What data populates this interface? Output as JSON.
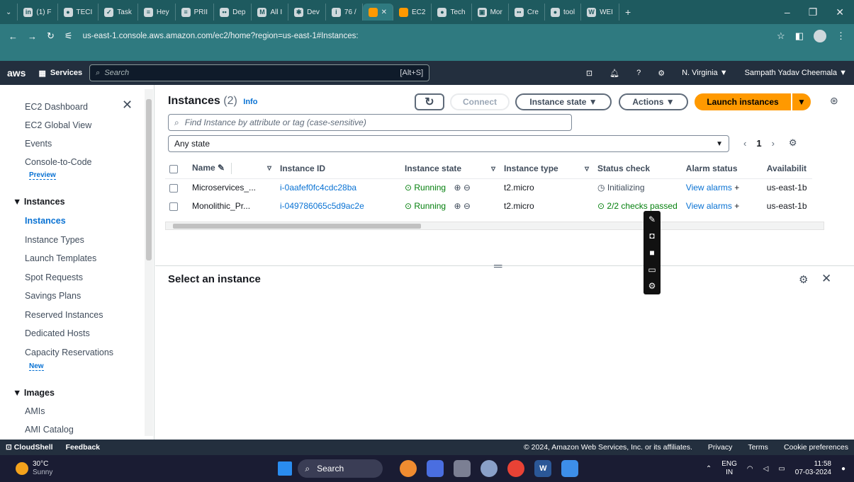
{
  "browser": {
    "tabs": [
      {
        "icon": "linkedin-icon",
        "label": "(1) F"
      },
      {
        "icon": "github-icon",
        "label": "TECI"
      },
      {
        "icon": "task-icon",
        "label": "Task"
      },
      {
        "icon": "doc-icon",
        "label": "Hey"
      },
      {
        "icon": "doc-icon",
        "label": "PRII"
      },
      {
        "icon": "devops-icon",
        "label": "Dep"
      },
      {
        "icon": "gmail-icon",
        "label": "All I"
      },
      {
        "icon": "dev-icon",
        "label": "Dev"
      },
      {
        "icon": "info-icon",
        "label": "76 /"
      },
      {
        "icon": "aws-tab-icon",
        "label": ""
      },
      {
        "icon": "ec2-icon",
        "label": "EC2"
      },
      {
        "icon": "github-icon",
        "label": "Tech"
      },
      {
        "icon": "mon-icon",
        "label": "Mor"
      },
      {
        "icon": "devops-icon",
        "label": "Cre"
      },
      {
        "icon": "github-icon",
        "label": "tool"
      },
      {
        "icon": "wordpress-icon",
        "label": "WEI"
      }
    ],
    "url": "us-east-1.console.aws.amazon.com/ec2/home?region=us-east-1#Instances:"
  },
  "awsnav": {
    "logo": "aws",
    "services": "Services",
    "search_placeholder": "Search",
    "search_shortcut": "[Alt+S]",
    "region": "N. Virginia ▼",
    "user": "Sampath Yadav Cheemala ▼"
  },
  "sidebar": {
    "top": [
      "EC2 Dashboard",
      "EC2 Global View",
      "Events",
      "Console-to-Code"
    ],
    "preview_badge": "Preview",
    "instances_header": "Instances",
    "instances_items": [
      "Instances",
      "Instance Types",
      "Launch Templates",
      "Spot Requests",
      "Savings Plans",
      "Reserved Instances",
      "Dedicated Hosts",
      "Capacity Reservations"
    ],
    "new_badge": "New",
    "images_header": "Images",
    "images_items": [
      "AMIs",
      "AMI Catalog"
    ]
  },
  "main": {
    "title": "Instances",
    "count": "(2)",
    "info": "Info",
    "connect": "Connect",
    "instance_state": "Instance state ▼",
    "actions": "Actions ▼",
    "launch": "Launch instances",
    "filter_placeholder": "Find Instance by attribute or tag (case-sensitive)",
    "state_filter": "Any state",
    "page": "1",
    "columns": [
      "Name",
      "Instance ID",
      "Instance state",
      "Instance type",
      "Status check",
      "Alarm status",
      "Availabilit"
    ],
    "rows": [
      {
        "name": "Microservices_...",
        "id": "i-0aafef0fc4cdc28ba",
        "state": "Running",
        "type": "t2.micro",
        "status": "Initializing",
        "alarm": "View alarms",
        "az": "us-east-1b"
      },
      {
        "name": "Monolithic_Pr...",
        "id": "i-049786065c5d9ac2e",
        "state": "Running",
        "type": "t2.micro",
        "status": "2/2 checks passed",
        "alarm": "View alarms",
        "az": "us-east-1b"
      }
    ],
    "select_title": "Select an instance"
  },
  "footer": {
    "cloudshell": "CloudShell",
    "feedback": "Feedback",
    "copyright": "© 2024, Amazon Web Services, Inc. or its affiliates.",
    "privacy": "Privacy",
    "terms": "Terms",
    "cookies": "Cookie preferences"
  },
  "taskbar": {
    "temp": "30°C",
    "weather": "Sunny",
    "search": "Search",
    "lang": "ENG",
    "lang2": "IN",
    "time": "11:58",
    "date": "07-03-2024"
  }
}
